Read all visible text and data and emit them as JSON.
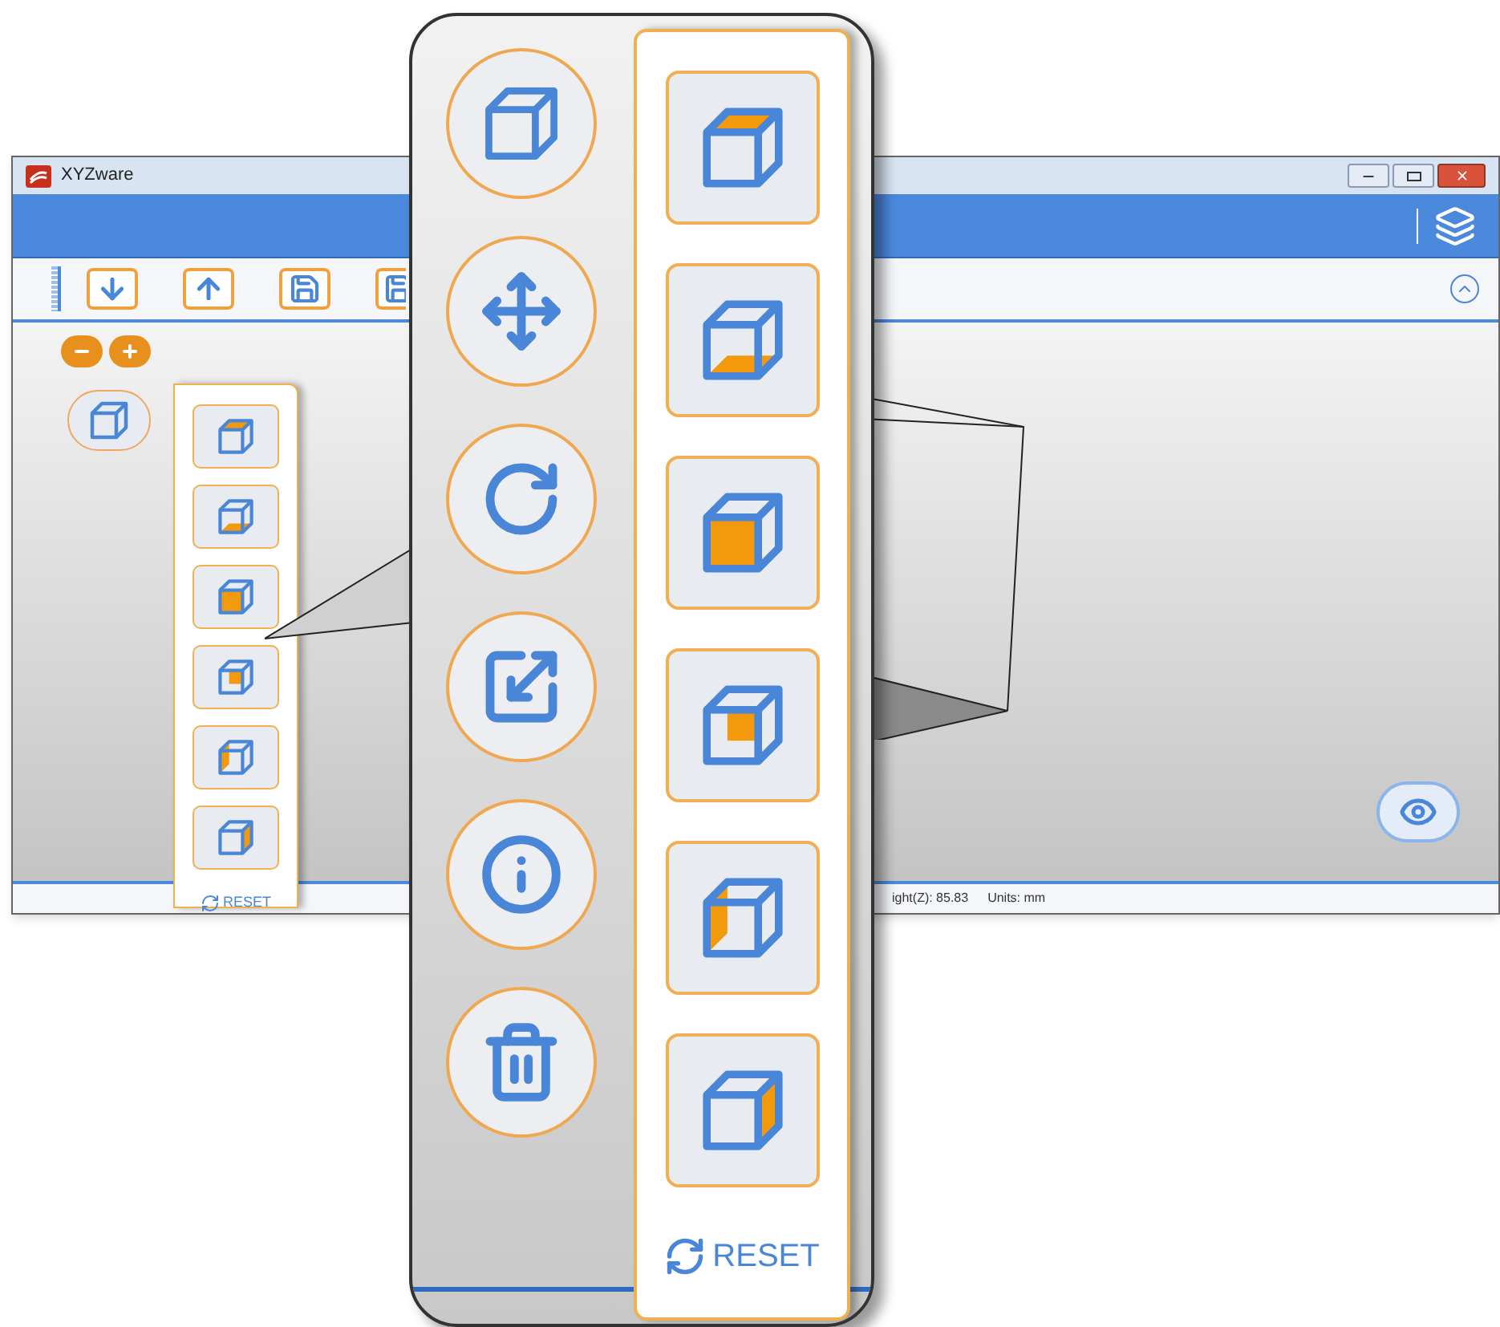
{
  "window": {
    "title": "XYZware"
  },
  "side_panel": {
    "faces": [
      {
        "kind": "top"
      },
      {
        "kind": "bottom"
      },
      {
        "kind": "front"
      },
      {
        "kind": "back"
      },
      {
        "kind": "left"
      },
      {
        "kind": "right"
      }
    ],
    "reset_label": "RESET"
  },
  "status_bar": {
    "height_reading": "ight(Z): 85.83",
    "units": "Units: mm"
  },
  "callout": {
    "tools": [
      {
        "kind": "view"
      },
      {
        "kind": "move"
      },
      {
        "kind": "rotate"
      },
      {
        "kind": "scale"
      },
      {
        "kind": "info"
      },
      {
        "kind": "delete"
      }
    ],
    "faces": [
      {
        "kind": "top"
      },
      {
        "kind": "bottom"
      },
      {
        "kind": "front"
      },
      {
        "kind": "back"
      },
      {
        "kind": "left"
      },
      {
        "kind": "right"
      }
    ],
    "reset_label": "RESET"
  }
}
